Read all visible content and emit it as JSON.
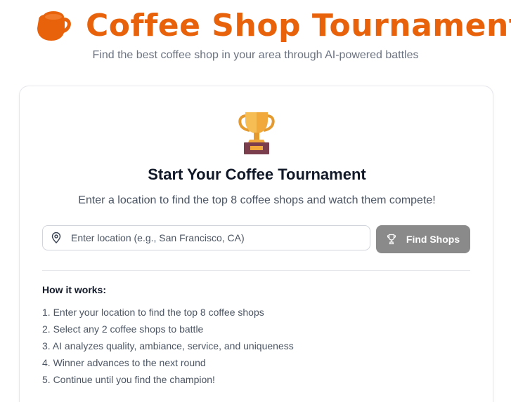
{
  "header": {
    "title": "Coffee Shop Tournament",
    "subtitle": "Find the best coffee shop in your area through AI-powered battles",
    "icon": "coffee-cup-icon"
  },
  "colors": {
    "brand": "#e8620b",
    "button_bg": "#8a8a8a",
    "trophy_gold": "#f2a93b",
    "trophy_base": "#7a3e4d"
  },
  "card": {
    "icon": "trophy-icon",
    "title": "Start Your Coffee Tournament",
    "description": "Enter a location to find the top 8 coffee shops and watch them compete!",
    "search": {
      "placeholder": "Enter location (e.g., San Francisco, CA)",
      "value": "",
      "icon": "map-pin-icon"
    },
    "button": {
      "label": "Find Shops",
      "icon": "trophy-outline-icon"
    },
    "how_it_works": {
      "title": "How it works:",
      "steps": [
        "1. Enter your location to find the top 8 coffee shops",
        "2. Select any 2 coffee shops to battle",
        "3. AI analyzes quality, ambiance, service, and uniqueness",
        "4. Winner advances to the next round",
        "5. Continue until you find the champion!"
      ]
    }
  }
}
